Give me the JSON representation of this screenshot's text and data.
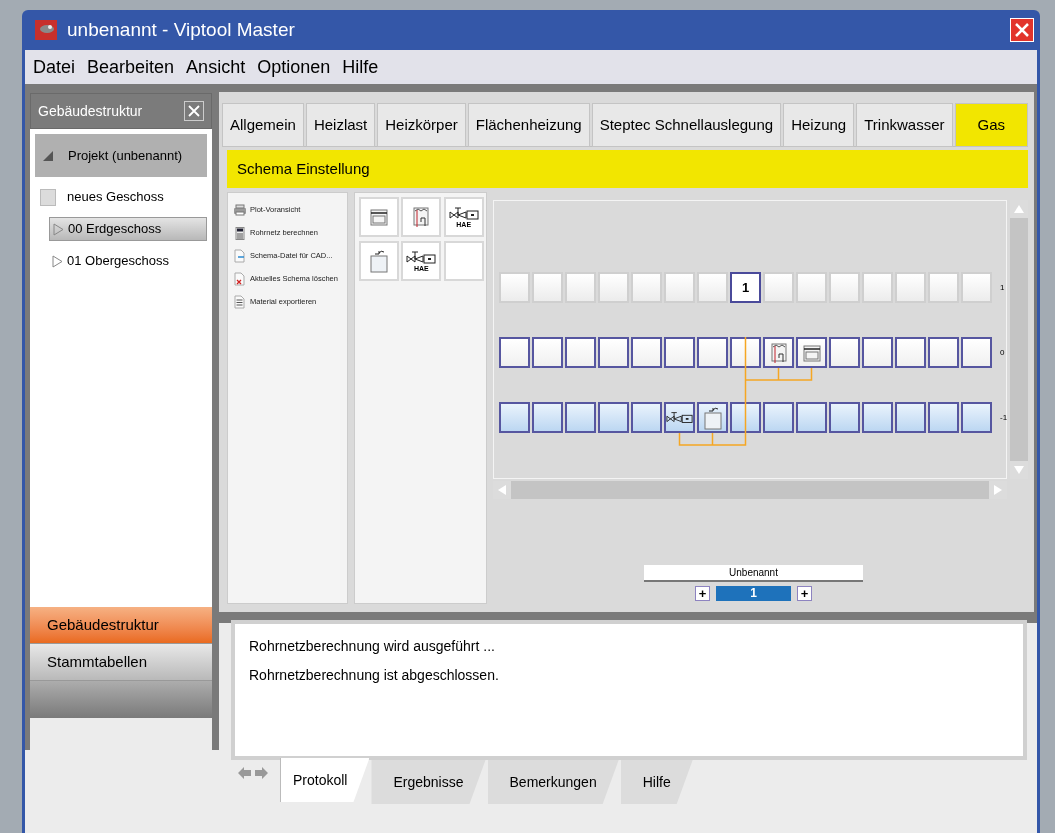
{
  "window": {
    "title": "unbenannt - Viptool Master"
  },
  "menu": [
    "Datei",
    "Bearbeiten",
    "Ansicht",
    "Optionen",
    "Hilfe"
  ],
  "sidebar": {
    "title": "Gebäudestruktur",
    "tree": [
      {
        "label": "Projekt (unbenannt)",
        "expanded": true,
        "children": [
          {
            "kind": "action",
            "label": "neues Geschoss"
          },
          {
            "kind": "floor",
            "label": "00 Erdgeschoss",
            "selected": true,
            "expanded": false
          },
          {
            "kind": "floor",
            "label": "01 Obergeschoss",
            "selected": false,
            "expanded": false
          }
        ]
      }
    ],
    "nav": [
      {
        "label": "Gebäudestruktur",
        "selected": true
      },
      {
        "label": "Stammtabellen",
        "selected": false
      }
    ]
  },
  "tabs": [
    {
      "label": "Allgemein",
      "selected": false
    },
    {
      "label": "Heizlast",
      "selected": false
    },
    {
      "label": "Heizkörper",
      "selected": false
    },
    {
      "label": "Flächenheizung",
      "selected": false
    },
    {
      "label": "Steptec Schnellauslegung",
      "selected": false
    },
    {
      "label": "Heizung",
      "selected": false
    },
    {
      "label": "Trinkwasser",
      "selected": false
    },
    {
      "label": "Gas",
      "selected": true
    }
  ],
  "section_title": "Schema Einstellung",
  "actions": [
    {
      "kind": "print",
      "label": "Plot-Voransicht"
    },
    {
      "kind": "calc",
      "label": "Rohrnetz berechnen"
    },
    {
      "kind": "export",
      "label": "Schema-Datei für CAD..."
    },
    {
      "kind": "delete",
      "label": "Aktuelles Schema löschen"
    },
    {
      "kind": "list",
      "label": "Material exportieren"
    }
  ],
  "palette": [
    {
      "kind": "stove"
    },
    {
      "kind": "heater"
    },
    {
      "kind": "valve",
      "text": "HAE"
    },
    {
      "kind": "tank"
    },
    {
      "kind": "valve2",
      "text": "HAE"
    },
    {
      "kind": "empty"
    }
  ],
  "schema": {
    "rows": [
      {
        "label": "1",
        "cells": [
          {
            "kind": "empty"
          },
          {
            "kind": "empty"
          },
          {
            "kind": "empty"
          },
          {
            "kind": "empty"
          },
          {
            "kind": "empty"
          },
          {
            "kind": "empty"
          },
          {
            "kind": "empty"
          },
          {
            "kind": "number",
            "text": "1"
          },
          {
            "kind": "empty"
          },
          {
            "kind": "empty"
          },
          {
            "kind": "empty"
          },
          {
            "kind": "empty"
          },
          {
            "kind": "empty"
          },
          {
            "kind": "empty"
          },
          {
            "kind": "empty"
          }
        ]
      },
      {
        "label": "0",
        "cells": [
          {
            "kind": "empty"
          },
          {
            "kind": "empty"
          },
          {
            "kind": "empty"
          },
          {
            "kind": "empty"
          },
          {
            "kind": "empty"
          },
          {
            "kind": "empty"
          },
          {
            "kind": "empty"
          },
          {
            "kind": "empty"
          },
          {
            "kind": "heater"
          },
          {
            "kind": "stove"
          },
          {
            "kind": "empty"
          },
          {
            "kind": "empty"
          },
          {
            "kind": "empty"
          },
          {
            "kind": "empty"
          },
          {
            "kind": "empty"
          }
        ]
      },
      {
        "label": "-1",
        "cells": [
          {
            "kind": "empty"
          },
          {
            "kind": "empty"
          },
          {
            "kind": "empty"
          },
          {
            "kind": "empty"
          },
          {
            "kind": "empty"
          },
          {
            "kind": "valve"
          },
          {
            "kind": "tank"
          },
          {
            "kind": "empty"
          },
          {
            "kind": "empty"
          },
          {
            "kind": "empty"
          },
          {
            "kind": "empty"
          },
          {
            "kind": "empty"
          },
          {
            "kind": "empty"
          },
          {
            "kind": "empty"
          },
          {
            "kind": "empty"
          }
        ]
      }
    ],
    "name": "Unbenannt",
    "counter": "1",
    "plus": "+"
  },
  "log": [
    "Rohrnetzberechnung wird ausgeführt ...",
    "Rohrnetzberechnung ist abgeschlossen."
  ],
  "bottom_tabs": [
    {
      "label": "Protokoll",
      "selected": true
    },
    {
      "label": "Ergebnisse",
      "selected": false
    },
    {
      "label": "Bemerkungen",
      "selected": false
    },
    {
      "label": "Hilfe",
      "selected": false
    }
  ]
}
